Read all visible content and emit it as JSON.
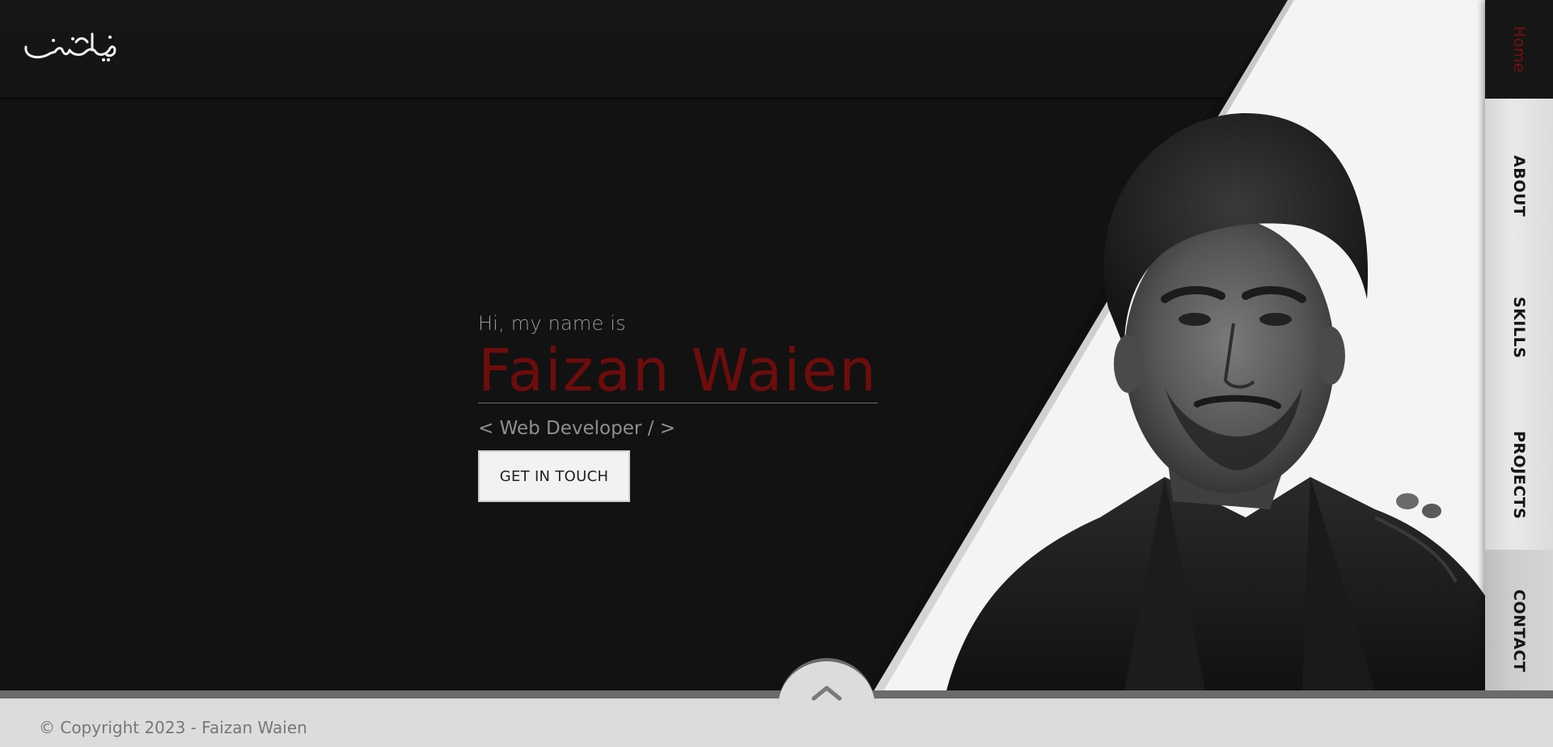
{
  "brand": {
    "logo_text": "فیضان"
  },
  "hero": {
    "greeting": "Hi, my name is",
    "name": "Faizan Waien",
    "role": "< Web Developer / >",
    "cta_label": "GET IN TOUCH"
  },
  "nav": {
    "items": [
      {
        "label": "Home",
        "active": true
      },
      {
        "label": "ABOUT",
        "active": false
      },
      {
        "label": "SKILLS",
        "active": false
      },
      {
        "label": "PROJECTS",
        "active": false
      },
      {
        "label": "CONTACT",
        "active": false
      }
    ]
  },
  "footer": {
    "copyright": "© Copyright 2023 - Faizan Waien"
  },
  "icons": {
    "scroll_top": "chevron-up-icon",
    "portrait": "profile-photo"
  },
  "colors": {
    "background": "#121212",
    "accent": "#6e0c0c",
    "panel": "#f4f4f4",
    "footer": "#dcdcdc"
  }
}
